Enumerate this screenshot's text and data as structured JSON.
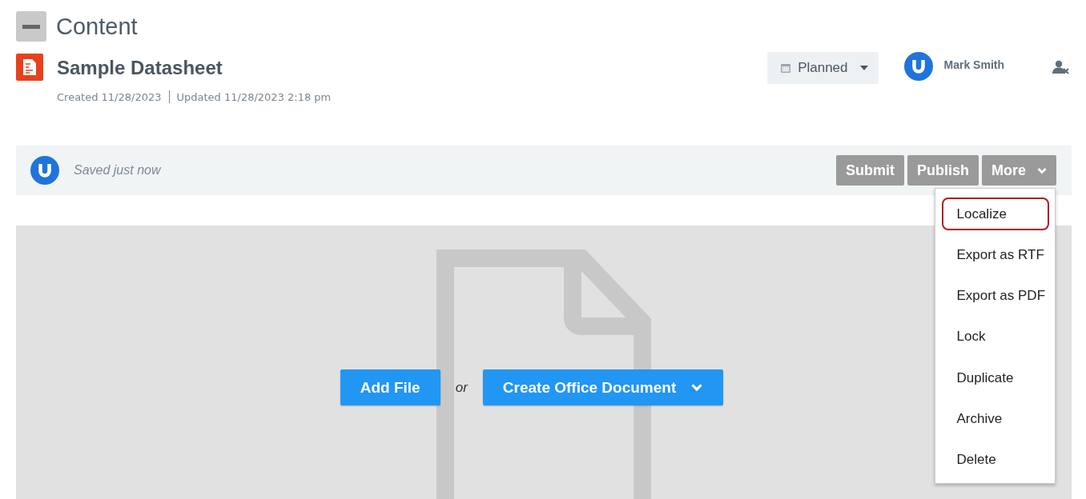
{
  "section": {
    "title": "Content"
  },
  "document": {
    "title": "Sample Datasheet",
    "created": "Created 11/28/2023",
    "updated": "Updated 11/28/2023 2:18 pm",
    "status": "Planned",
    "assignee": "Mark Smith"
  },
  "toolbar": {
    "save_status": "Saved just now",
    "buttons": [
      "Submit",
      "Publish",
      "More"
    ]
  },
  "more_menu": [
    {
      "label": "Localize",
      "selected": true
    },
    {
      "label": "Export as RTF",
      "selected": false
    },
    {
      "label": "Export as PDF",
      "selected": false
    },
    {
      "label": "Lock",
      "selected": false
    },
    {
      "label": "Duplicate",
      "selected": false
    },
    {
      "label": "Archive",
      "selected": false
    },
    {
      "label": "Delete",
      "selected": false
    }
  ],
  "upload": {
    "add_file": "Add File",
    "separator": "or",
    "create": "Create Office Document"
  }
}
